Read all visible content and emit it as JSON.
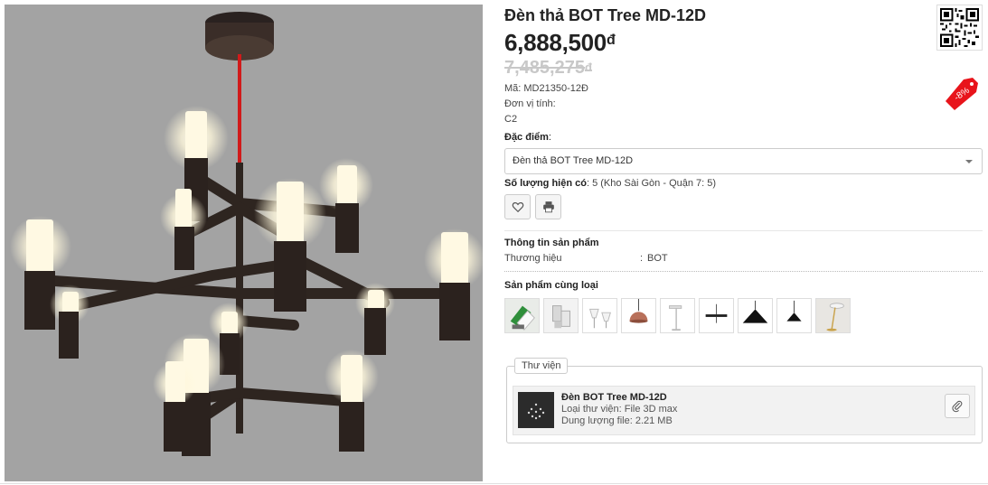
{
  "product": {
    "title": "Đèn thả BOT Tree MD-12D",
    "price": "6,888,500",
    "price_currency": "đ",
    "old_price": "7,485,275",
    "old_price_currency": "đ",
    "code_label": "Mã: MD21350-12Đ",
    "unit_label": "Đơn vị tính:",
    "unit_value": "C2",
    "discount": "-8%"
  },
  "features": {
    "label": "Đặc điểm",
    "label_suffix": ":",
    "selected": "Đèn thả BOT Tree MD-12D"
  },
  "stock": {
    "label": "Số lượng hiện có",
    "value": ": 5 (Kho Sài Gòn - Quận 7: 5)"
  },
  "info_section": {
    "title": "Thông tin sản phẩm",
    "rows": [
      {
        "key": "Thương hiệu",
        "sep": ":",
        "value": "BOT"
      }
    ]
  },
  "related": {
    "title": "Sản phẩm cùng loại"
  },
  "library": {
    "legend": "Thư viện",
    "item": {
      "name": "Đèn BOT Tree MD-12D",
      "type": "Loại thư viện: File 3D max",
      "size": "Dung lượng file: 2.21 MB"
    }
  },
  "colors": {
    "discount_tag": "#e8141b",
    "image_bg": "#a3a3a3",
    "cord": "#d11a1a"
  },
  "icons": {
    "favorite": "heart-icon",
    "print": "printer-icon",
    "attach": "paperclip-icon"
  }
}
